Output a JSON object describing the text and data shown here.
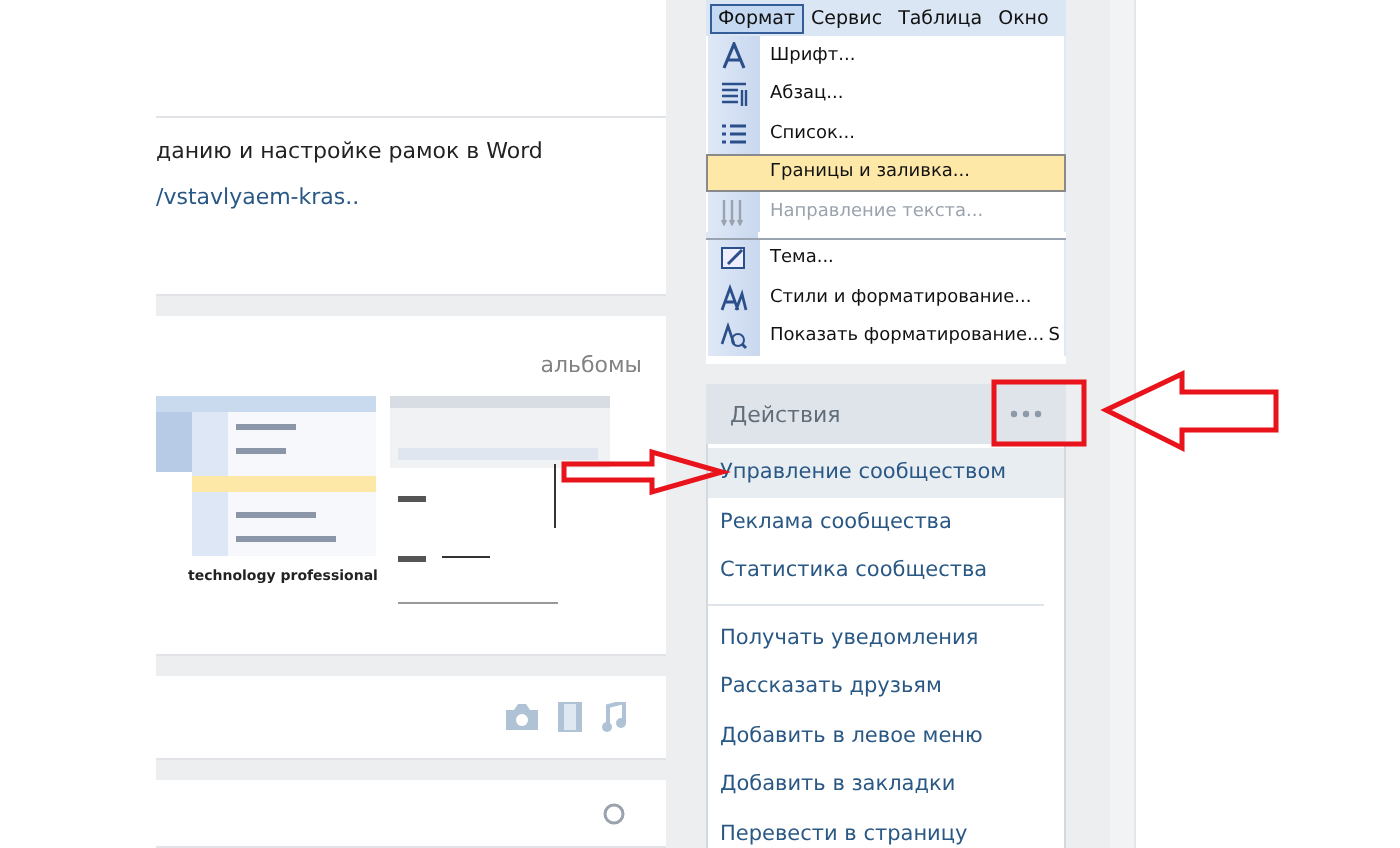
{
  "post": {
    "text": "данию и настройке рамок в Word",
    "link": "/vstavlyaem-kras.."
  },
  "albums": {
    "title": "альбомы",
    "caption": "technology professional"
  },
  "word_menu": {
    "menubar": [
      {
        "label": "Формат",
        "selected": true
      },
      {
        "label": "Сервис",
        "selected": false
      },
      {
        "label": "Таблица",
        "selected": false
      },
      {
        "label": "Окно",
        "selected": false
      }
    ],
    "items": [
      {
        "kind": "item",
        "label": "Шрифт...",
        "selected": false,
        "disabled": false
      },
      {
        "kind": "item",
        "label": "Абзац...",
        "selected": false,
        "disabled": false
      },
      {
        "kind": "item",
        "label": "Список...",
        "selected": false,
        "disabled": false
      },
      {
        "kind": "item",
        "label": "Границы и заливка...",
        "selected": true,
        "disabled": false
      },
      {
        "kind": "item",
        "label": "Направление текста...",
        "selected": false,
        "disabled": true
      },
      {
        "kind": "separator"
      },
      {
        "kind": "item",
        "label": "Тема...",
        "selected": false,
        "disabled": false
      },
      {
        "kind": "item",
        "label": "Стили и форматирование...",
        "selected": false,
        "disabled": false
      },
      {
        "kind": "item",
        "label": "Показать форматирование...",
        "shortcut": "S",
        "selected": false,
        "disabled": false
      }
    ]
  },
  "actions": {
    "title": "Действия",
    "items": [
      {
        "kind": "item",
        "label": "Управление сообществом",
        "selected": true
      },
      {
        "kind": "item",
        "label": "Реклама сообщества",
        "selected": false
      },
      {
        "kind": "item",
        "label": "Статистика сообщества",
        "selected": false
      },
      {
        "kind": "separator"
      },
      {
        "kind": "item",
        "label": "Получать уведомления",
        "selected": false
      },
      {
        "kind": "item",
        "label": "Рассказать друзьям",
        "selected": false
      },
      {
        "kind": "item",
        "label": "Добавить в левое меню",
        "selected": false
      },
      {
        "kind": "item",
        "label": "Добавить в закладки",
        "selected": false
      },
      {
        "kind": "item",
        "label": "Перевести в страницу",
        "selected": false
      }
    ]
  }
}
